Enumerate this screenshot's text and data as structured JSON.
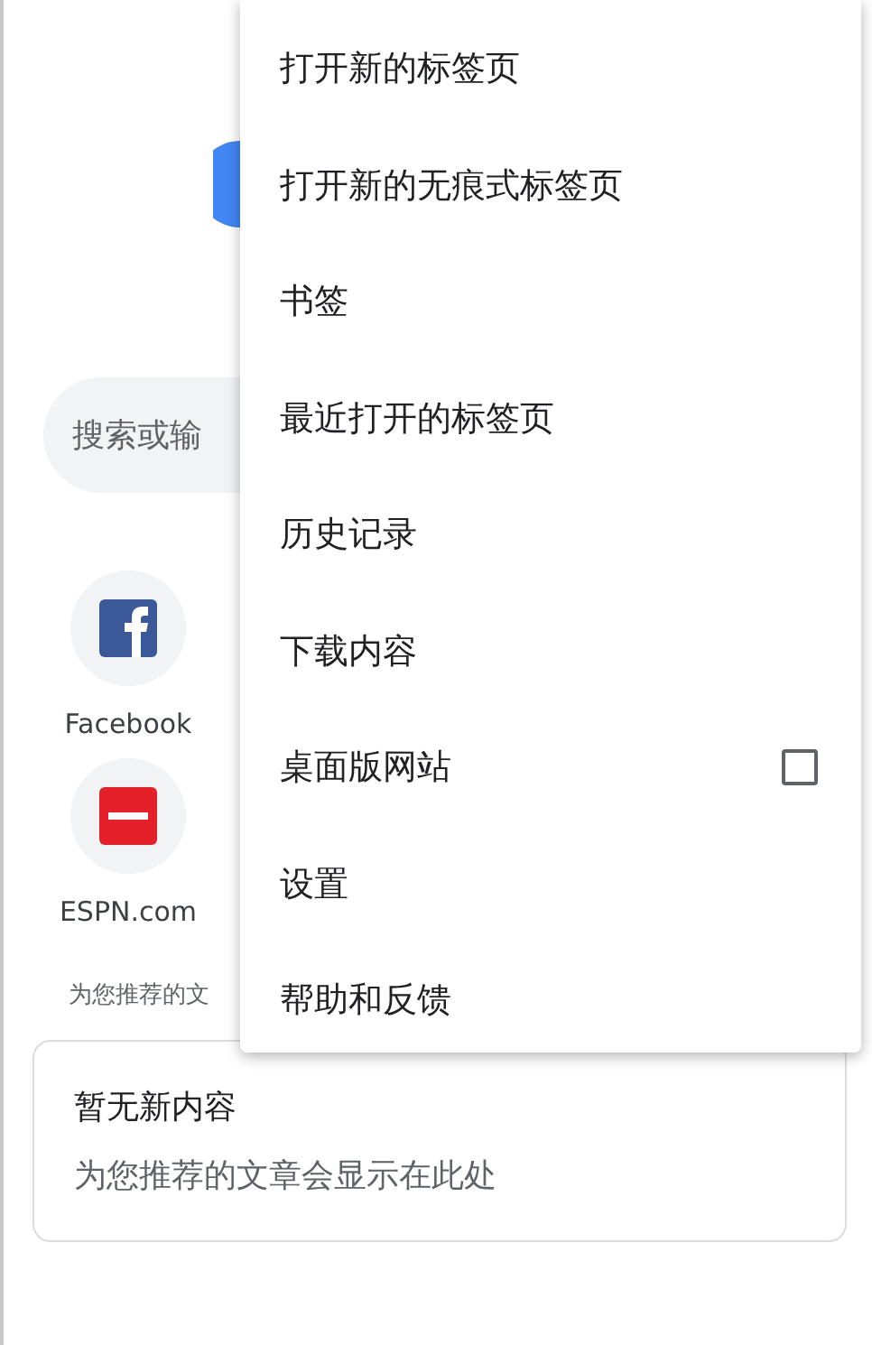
{
  "new_tab_page": {
    "search": {
      "placeholder": "搜索或输"
    },
    "shortcuts": [
      {
        "label": "Facebook",
        "kind": "facebook"
      },
      {
        "label": "ESPN.com",
        "kind": "espn"
      }
    ],
    "section_label": "为您推荐的文",
    "feed_card": {
      "title": "暂无新内容",
      "message": "为您推荐的文章会显示在此处"
    }
  },
  "menu": {
    "items": [
      {
        "label": "打开新的标签页",
        "kind": "plain"
      },
      {
        "label": "打开新的无痕式标签页",
        "kind": "plain"
      },
      {
        "label": "书签",
        "kind": "plain"
      },
      {
        "label": "最近打开的标签页",
        "kind": "plain"
      },
      {
        "label": "历史记录",
        "kind": "plain"
      },
      {
        "label": "下载内容",
        "kind": "plain"
      },
      {
        "label": "桌面版网站",
        "kind": "checkbox",
        "checked": false
      },
      {
        "label": "设置",
        "kind": "plain"
      },
      {
        "label": "帮助和反馈",
        "kind": "plain"
      }
    ]
  }
}
